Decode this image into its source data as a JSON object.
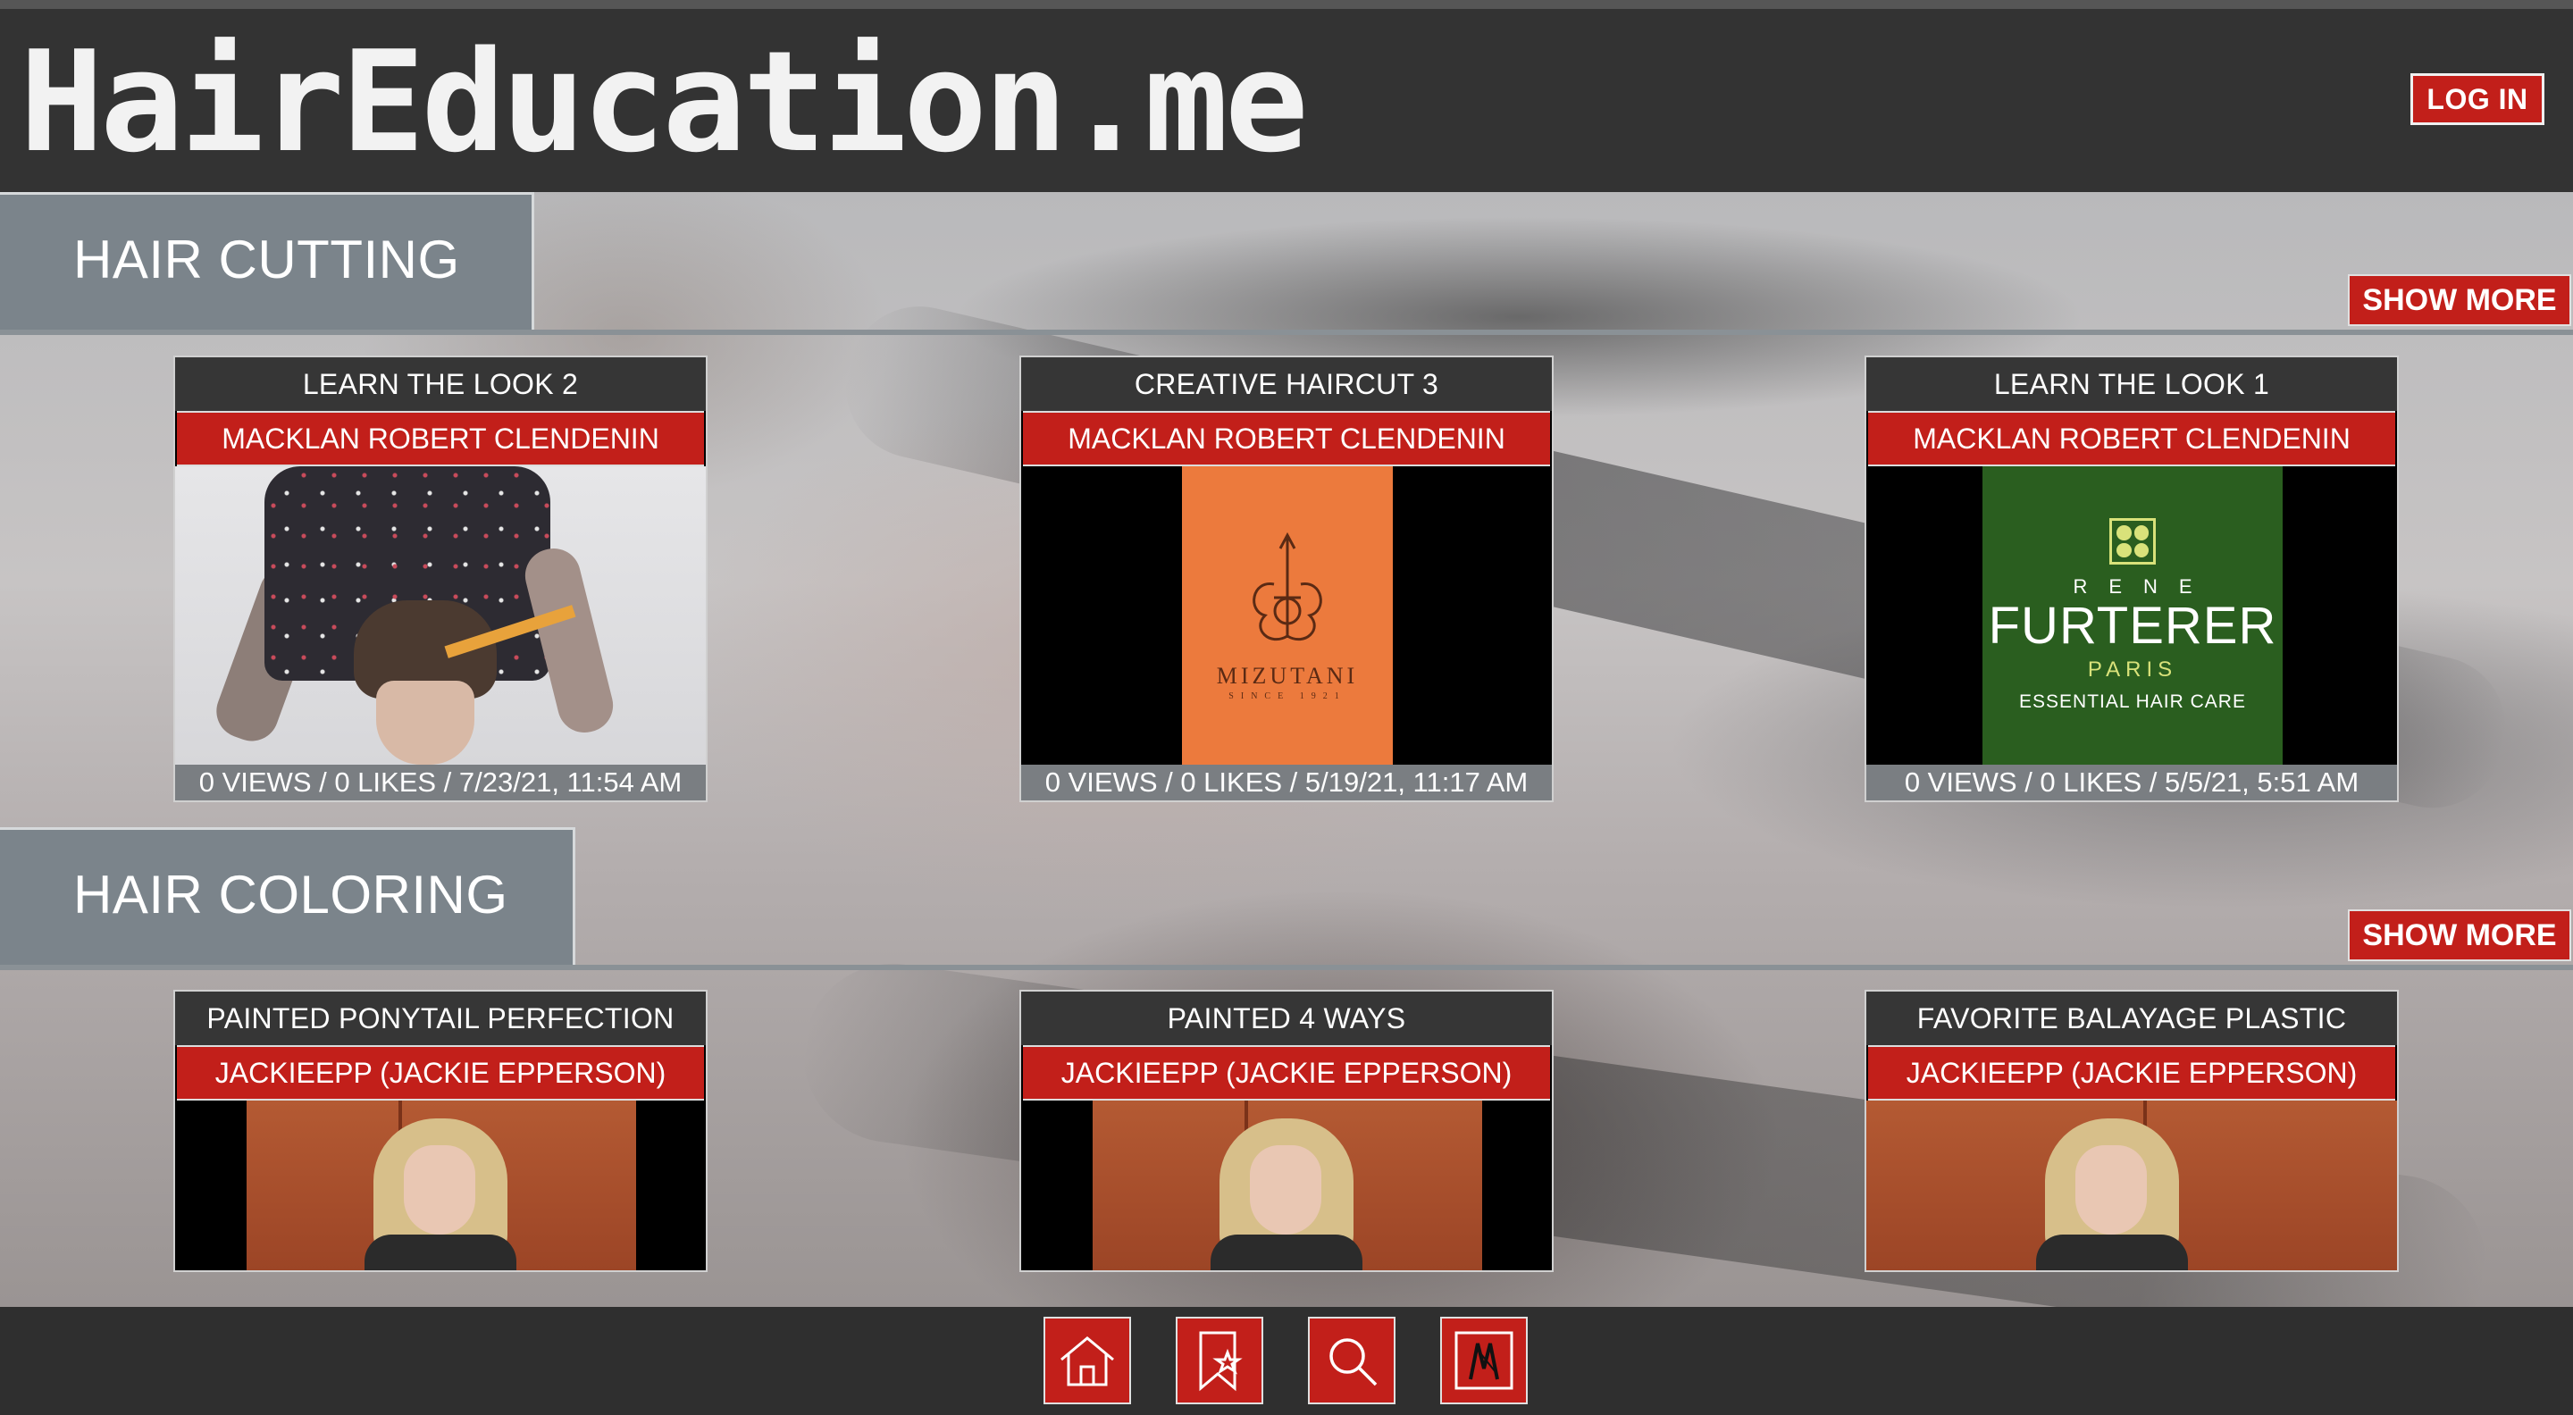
{
  "header": {
    "logo": "HairEducation.me",
    "login_label": "LOG IN"
  },
  "sections": [
    {
      "title": "HAIR CUTTING",
      "show_more": "SHOW MORE",
      "cards": [
        {
          "title": "LEARN THE LOOK 2",
          "author": "MACKLAN ROBERT CLENDENIN",
          "meta": "0 VIEWS / 0 LIKES / 7/23/21, 11:54 AM"
        },
        {
          "title": "CREATIVE HAIRCUT 3",
          "author": "MACKLAN ROBERT CLENDENIN",
          "meta": "0 VIEWS / 0 LIKES / 5/19/21, 11:17 AM",
          "thumb_brand": "MIZUTANI",
          "thumb_since": "SINCE 1921"
        },
        {
          "title": "LEARN THE LOOK 1",
          "author": "MACKLAN ROBERT CLENDENIN",
          "meta": "0 VIEWS / 0 LIKES / 5/5/21, 5:51 AM",
          "thumb_rene": "RENE",
          "thumb_brand": "FURTERER",
          "thumb_paris": "PARIS",
          "thumb_care": "ESSENTIAL HAIR CARE"
        }
      ]
    },
    {
      "title": "HAIR COLORING",
      "show_more": "SHOW MORE",
      "cards": [
        {
          "title": "PAINTED PONYTAIL PERFECTION",
          "author": "JACKIEEPP (JACKIE EPPERSON)"
        },
        {
          "title": "PAINTED 4 WAYS",
          "author": "JACKIEEPP (JACKIE EPPERSON)"
        },
        {
          "title": "FAVORITE BALAYAGE PLASTIC",
          "author": "JACKIEEPP (JACKIE EPPERSON)"
        }
      ]
    }
  ],
  "bottom_nav": [
    {
      "icon": "home-icon"
    },
    {
      "icon": "bookmark-star-icon"
    },
    {
      "icon": "search-icon"
    },
    {
      "icon": "profile-logo-icon"
    }
  ],
  "colors": {
    "accent_red": "#c21f1a",
    "header_bg": "#333333",
    "section_tab": "#7b848b"
  }
}
